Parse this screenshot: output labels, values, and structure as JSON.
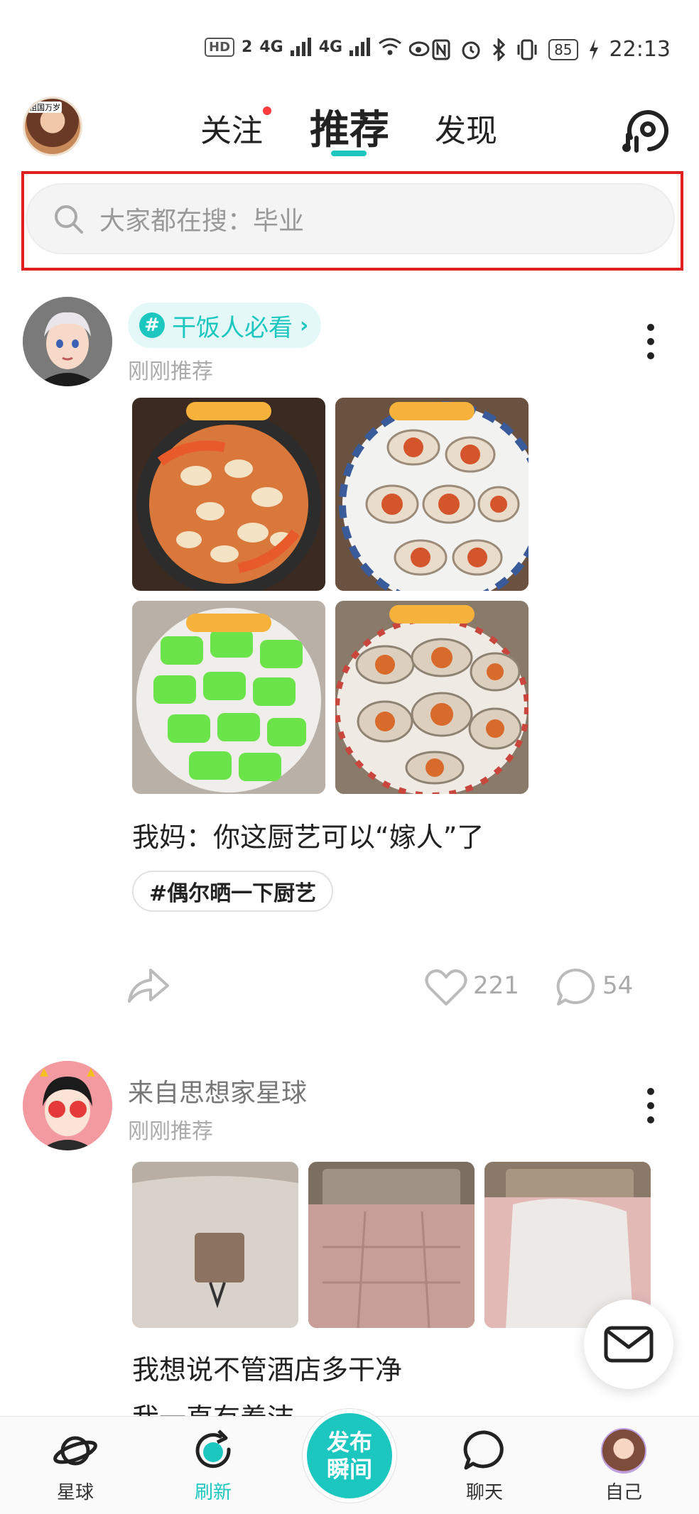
{
  "status_bar": {
    "left": [
      "HD",
      "2",
      "4G",
      "4G"
    ],
    "battery": "85",
    "time": "22:13"
  },
  "top_nav": {
    "avatar_badge": "祖国万岁",
    "tabs": [
      {
        "label": "关注",
        "has_dot": true
      },
      {
        "label": "推荐",
        "active": true
      },
      {
        "label": "发现"
      }
    ]
  },
  "search": {
    "placeholder": "大家都在搜：毕业"
  },
  "posts": [
    {
      "topic": "干饭人必看",
      "time": "刚刚推荐",
      "images": [
        "clams-shrimp",
        "oysters-1",
        "green-jelly",
        "oysters-2"
      ],
      "caption": "我妈：你这厨艺可以“嫁人”了",
      "hashtag": "#偶尔晒一下厨艺",
      "likes": "221",
      "comments": "54"
    },
    {
      "from": "来自思想家星球",
      "time": "刚刚推荐",
      "images": [
        "hotel-bed-1",
        "hotel-bed-2",
        "hotel-bed-3"
      ],
      "caption_line1": "我想说不管酒店多干净",
      "caption_line2": "我一直有着洁"
    }
  ],
  "bottom_nav": {
    "items": [
      {
        "label": "星球"
      },
      {
        "label": "刷新",
        "active": true
      },
      {
        "label": "发布瞬间"
      },
      {
        "label": "聊天"
      },
      {
        "label": "自己"
      }
    ],
    "publish_line1": "发布",
    "publish_line2": "瞬间"
  },
  "colors": {
    "accent": "#1cc7c0",
    "highlight_box": "#e21f1f"
  }
}
